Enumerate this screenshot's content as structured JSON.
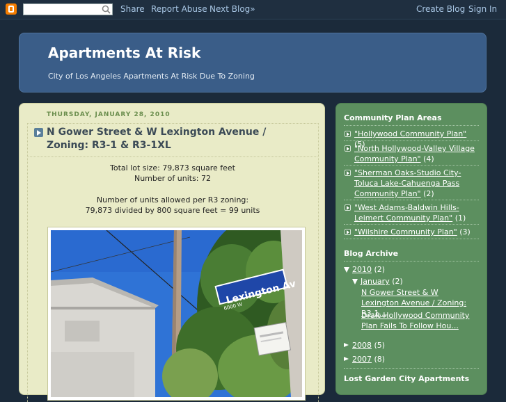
{
  "navbar": {
    "search_placeholder": "",
    "share": "Share",
    "report": "Report Abuse",
    "next": "Next Blog»",
    "create": "Create Blog",
    "signin": "Sign In"
  },
  "header": {
    "title": "Apartments At Risk",
    "description": "City of Los Angeles Apartments At Risk Due To Zoning"
  },
  "post": {
    "date": "THURSDAY, JANUARY 28, 2010",
    "title": "N Gower Street & W Lexington Avenue / Zoning: R3-1 & R3-1XL",
    "lines": [
      "Total lot size: 79,873 square feet",
      "Number of units: 72",
      "Number of units allowed per R3 zoning:",
      "79,873 divided by 800 square feet = 99 units"
    ],
    "sign_text": "Lexington Av",
    "sign_number": "6000 W"
  },
  "sidebar": {
    "plan_heading": "Community Plan Areas",
    "plans": [
      {
        "label": "\"Hollywood Community Plan\"",
        "count": "(5)"
      },
      {
        "label": "\"North Hollywood-Valley Village Community Plan\"",
        "count": "(4)"
      },
      {
        "label": "\"Sherman Oaks-Studio City-Toluca Lake-Cahuenga Pass Community Plan\"",
        "count": "(2)"
      },
      {
        "label": "\"West Adams-Baldwin Hills-Leimert Community Plan\"",
        "count": "(1)"
      },
      {
        "label": "\"Wilshire Community Plan\"",
        "count": "(3)"
      }
    ],
    "archive_heading": "Blog Archive",
    "archive": {
      "y2010": "2010",
      "y2010_count": "(2)",
      "january": "January",
      "january_count": "(2)",
      "posts": [
        "N Gower Street & W Lexington Avenue / Zoning: R3-1...",
        "Draft Hollywood Community Plan Fails To Follow Hou..."
      ],
      "y2008": "2008",
      "y2008_count": "(5)",
      "y2007": "2007",
      "y2007_count": "(8)"
    },
    "next_heading": "Lost Garden City Apartments"
  }
}
